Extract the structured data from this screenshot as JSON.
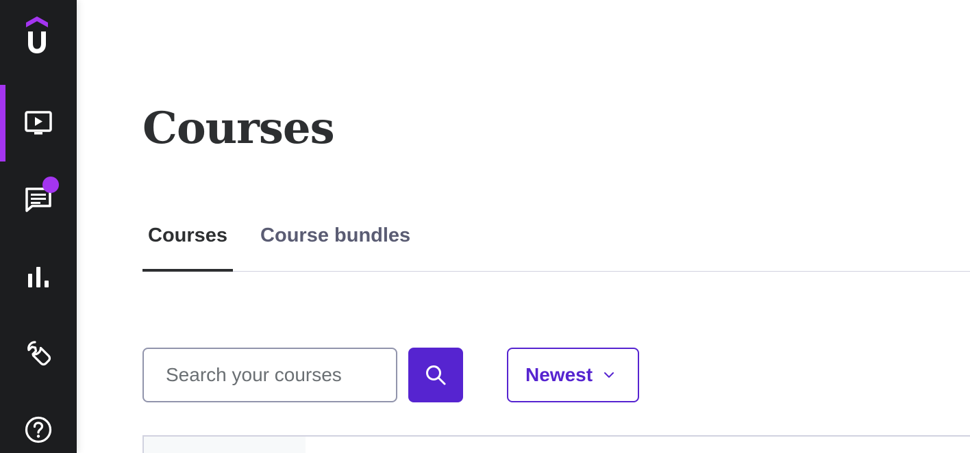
{
  "sidebar": {
    "logo_icon": "udemy-u-logo",
    "items": [
      {
        "name": "courses",
        "icon": "video-player-icon",
        "active": true
      },
      {
        "name": "communication",
        "icon": "message-icon",
        "has_notification": true
      },
      {
        "name": "performance",
        "icon": "bar-chart-icon"
      },
      {
        "name": "tools",
        "icon": "wrench-icon"
      },
      {
        "name": "help",
        "icon": "help-circle-icon"
      }
    ]
  },
  "main": {
    "title": "Courses",
    "tabs": [
      {
        "label": "Courses",
        "active": true
      },
      {
        "label": "Course bundles",
        "active": false
      }
    ],
    "search": {
      "placeholder": "Search your courses",
      "value": ""
    },
    "sort": {
      "selected": "Newest"
    }
  },
  "colors": {
    "sidebar_bg": "#1c1d1f",
    "accent_purple": "#a435f0",
    "primary_button": "#5624d0",
    "text_dark": "#2d2f31"
  }
}
